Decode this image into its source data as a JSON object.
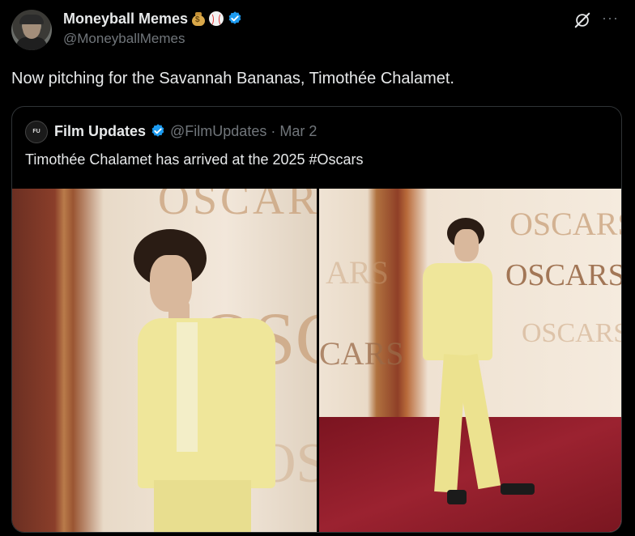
{
  "post": {
    "author_name": "Moneyball Memes",
    "author_emojis": [
      "money-bag",
      "baseball"
    ],
    "handle": "@MoneyballMemes",
    "text": "Now pitching for the Savannah Bananas, Timothée Chalamet.",
    "more_label": "···"
  },
  "quote": {
    "avatar_text": "FILM\nUPDATES",
    "author_name": "Film Updates",
    "handle": "@FilmUpdates",
    "separator": "·",
    "date": "Mar 2",
    "text": "Timothée Chalamet has arrived at the 2025 #Oscars",
    "backdrop_word": "OSCARS"
  },
  "colors": {
    "background": "#000000",
    "text_primary": "#e7e9ea",
    "text_secondary": "#71767b",
    "border": "#2f3336",
    "verified_blue": "#1d9bf0",
    "suit_yellow": "#efe69a",
    "carpet_red": "#8e1a24"
  }
}
